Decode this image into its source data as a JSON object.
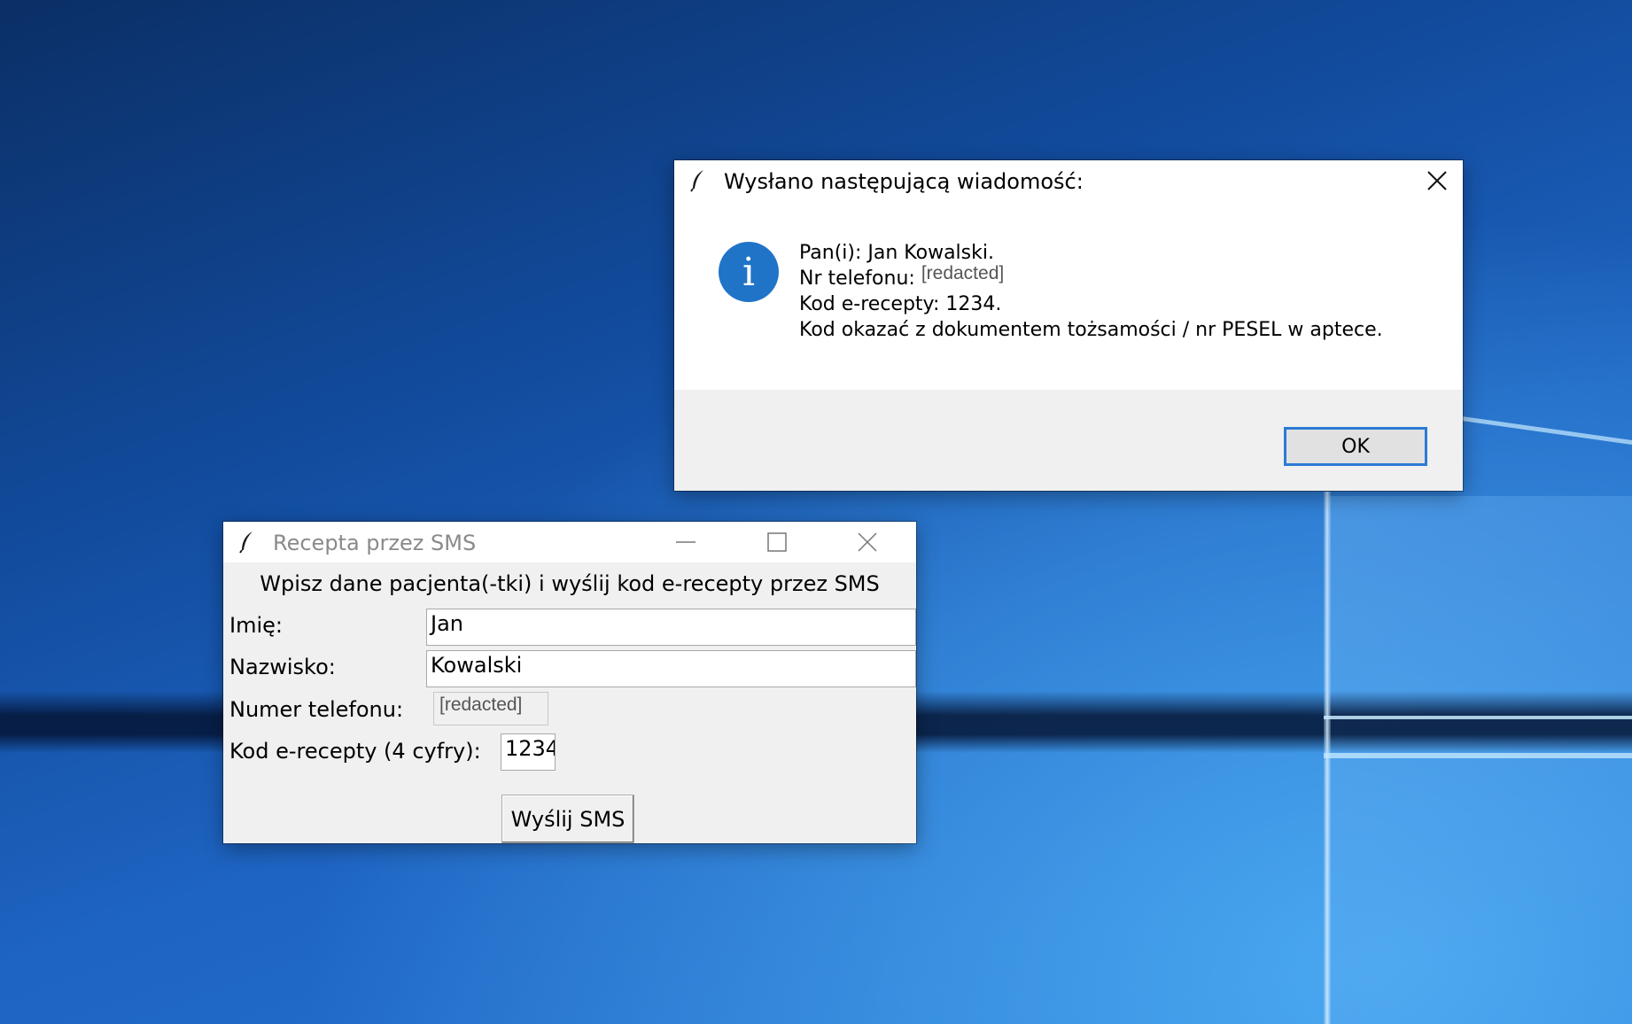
{
  "dialog": {
    "title": "Wysłano następującą wiadomość:",
    "icon": "info-icon",
    "icon_glyph": "i",
    "lines": {
      "line1": "Pan(i):  Jan Kowalski.",
      "phone_label": "Nr telefonu: ",
      "phone_value": "[redacted]",
      "line3": "Kod e-recepty:  1234.",
      "line4": "Kod okazać z dokumentem tożsamości / nr PESEL w aptece."
    },
    "ok_label": "OK",
    "accent_color": "#2b7bd4"
  },
  "app": {
    "title": "Recepta przez SMS",
    "heading": "Wpisz dane pacjenta(-tki) i wyślij kod e-recepty przez SMS",
    "fields": {
      "first_name": {
        "label": "Imię:",
        "value": "Jan"
      },
      "last_name": {
        "label": "Nazwisko:",
        "value": "Kowalski"
      },
      "phone": {
        "label": "Numer telefonu:",
        "value": "[redacted]"
      },
      "code": {
        "label": "Kod e-recepty (4 cyfry):",
        "value": "1234"
      }
    },
    "send_label": "Wyślij SMS"
  }
}
